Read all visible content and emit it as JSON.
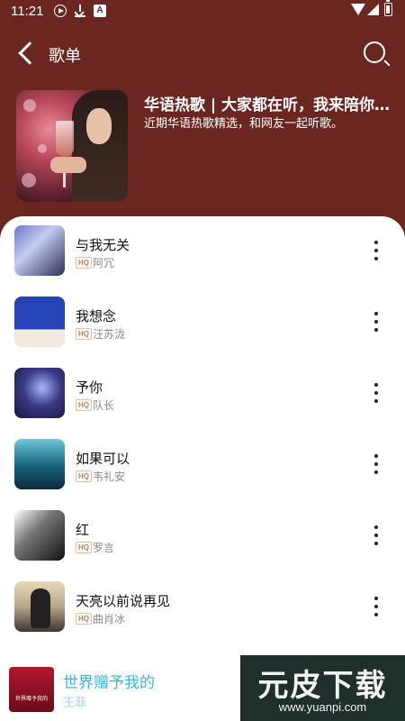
{
  "status_bar": {
    "time": "11:21",
    "icons": [
      "play-icon",
      "download-icon",
      "a-icon",
      "wifi-icon",
      "signal-icon",
      "battery-icon"
    ]
  },
  "header": {
    "title": "歌单"
  },
  "playlist": {
    "title": "华语热歌 | 大家都在听，我来陪你一起听",
    "description": "近期华语热歌精选，和网友一起听歌。"
  },
  "quality_badge": "HQ",
  "songs": [
    {
      "title": "与我无关",
      "artist": "阿冗"
    },
    {
      "title": "我想念",
      "artist": "汪苏泷"
    },
    {
      "title": "予你",
      "artist": "队长"
    },
    {
      "title": "如果可以",
      "artist": "韦礼安"
    },
    {
      "title": "红",
      "artist": "罗言"
    },
    {
      "title": "天亮以前说再见",
      "artist": "曲肖冰"
    }
  ],
  "now_playing": {
    "title": "世界赠予我的",
    "artist": "王菲",
    "cover_text": "世界赠予我的"
  },
  "watermark": {
    "big": "元皮下载",
    "small": "www.yuanpi.com"
  },
  "colors": {
    "header_bg": "#6b2620",
    "accent": "#3bb6d7"
  }
}
